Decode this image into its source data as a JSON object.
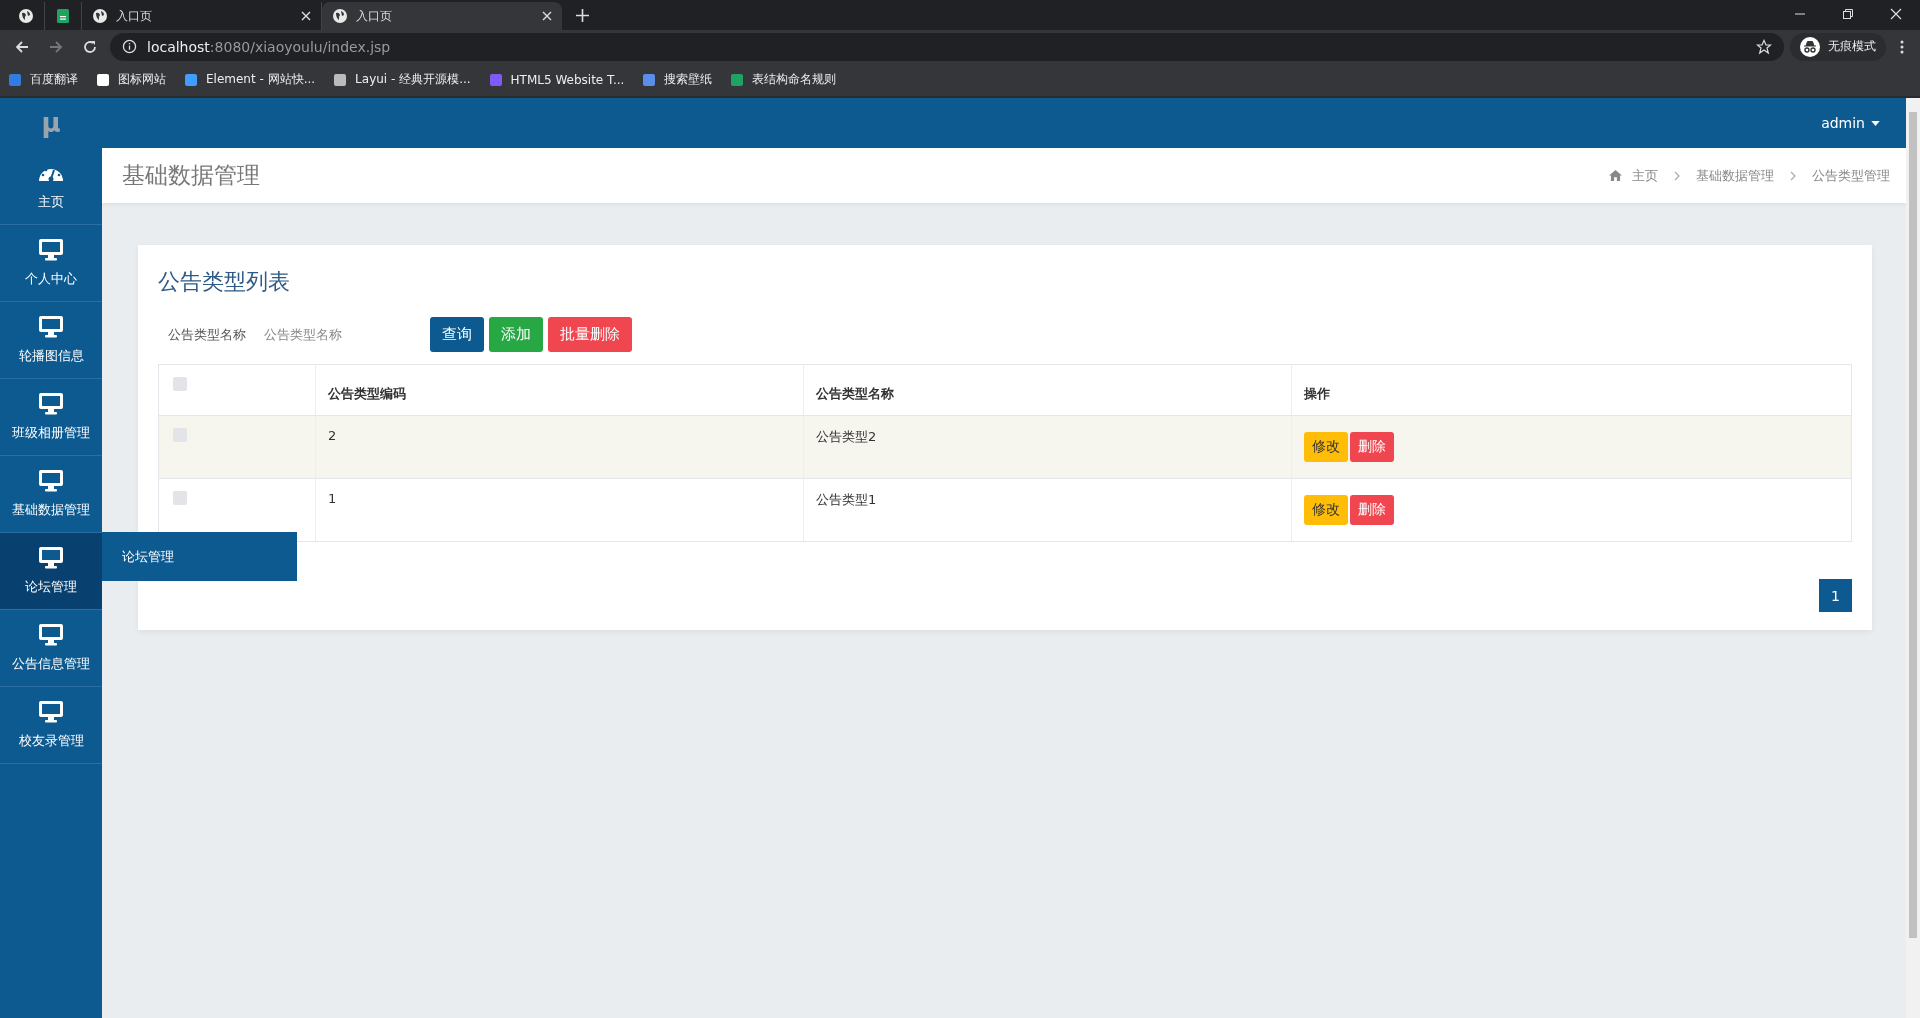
{
  "browser": {
    "tabs": [
      {
        "kind": "globe",
        "selected": false
      },
      {
        "kind": "sheet",
        "selected": false
      },
      {
        "kind": "globe",
        "label": "入口页",
        "selected": false
      },
      {
        "kind": "globe",
        "label": "入口页",
        "selected": true
      }
    ],
    "address": {
      "host": "localhost",
      "rest": ":8080/xiaoyoulu/index.jsp"
    },
    "profile": "无痕模式",
    "bookmarks": [
      {
        "kind": "translate",
        "label": "百度翻译"
      },
      {
        "kind": "flag",
        "label": "图标网站"
      },
      {
        "kind": "hexagon",
        "label": "Element - 网站快..."
      },
      {
        "kind": "layui",
        "label": "Layui - 经典开源模..."
      },
      {
        "kind": "purple",
        "label": "HTML5 Website T..."
      },
      {
        "kind": "fork",
        "label": "搜索壁纸"
      },
      {
        "kind": "sheet",
        "label": "表结构命名规则"
      }
    ]
  },
  "app": {
    "logo": "μ",
    "user": "admin",
    "sidebar": {
      "items": [
        {
          "kind": "dashboard",
          "label": "主页",
          "selected": false
        },
        {
          "kind": "monitor",
          "label": "个人中心",
          "selected": false
        },
        {
          "kind": "monitor",
          "label": "轮播图信息",
          "selected": false
        },
        {
          "kind": "monitor",
          "label": "班级相册管理",
          "selected": false
        },
        {
          "kind": "monitor",
          "label": "基础数据管理",
          "selected": false
        },
        {
          "kind": "monitor",
          "label": "论坛管理",
          "selected": true,
          "flyout": "论坛管理"
        },
        {
          "kind": "monitor",
          "label": "公告信息管理",
          "selected": false
        },
        {
          "kind": "monitor",
          "label": "校友录管理",
          "selected": false
        }
      ]
    },
    "page_title": "基础数据管理",
    "breadcrumbs": [
      "主页",
      "基础数据管理",
      "公告类型管理"
    ],
    "card": {
      "title": "公告类型列表",
      "search": {
        "label": "公告类型名称",
        "placeholder": "公告类型名称"
      },
      "buttons": [
        {
          "kind": "primary",
          "label": "查询"
        },
        {
          "kind": "success",
          "label": "添加"
        },
        {
          "kind": "danger",
          "label": "批量删除"
        }
      ],
      "table": {
        "header_checked": false,
        "columns": [
          "公告类型编码",
          "公告类型名称",
          "操作"
        ],
        "rows": [
          {
            "checked": false,
            "hovered": true,
            "cells": [
              "2",
              "公告类型2"
            ],
            "actions": [
              {
                "kind": "edit",
                "label": "修改"
              },
              {
                "kind": "delete",
                "label": "删除"
              }
            ]
          },
          {
            "checked": false,
            "hovered": false,
            "cells": [
              "1",
              "公告类型1"
            ],
            "actions": [
              {
                "kind": "edit",
                "label": "修改"
              },
              {
                "kind": "delete",
                "label": "删除"
              }
            ]
          }
        ]
      },
      "pagination": [
        {
          "label": "1",
          "selected": true
        }
      ]
    }
  }
}
